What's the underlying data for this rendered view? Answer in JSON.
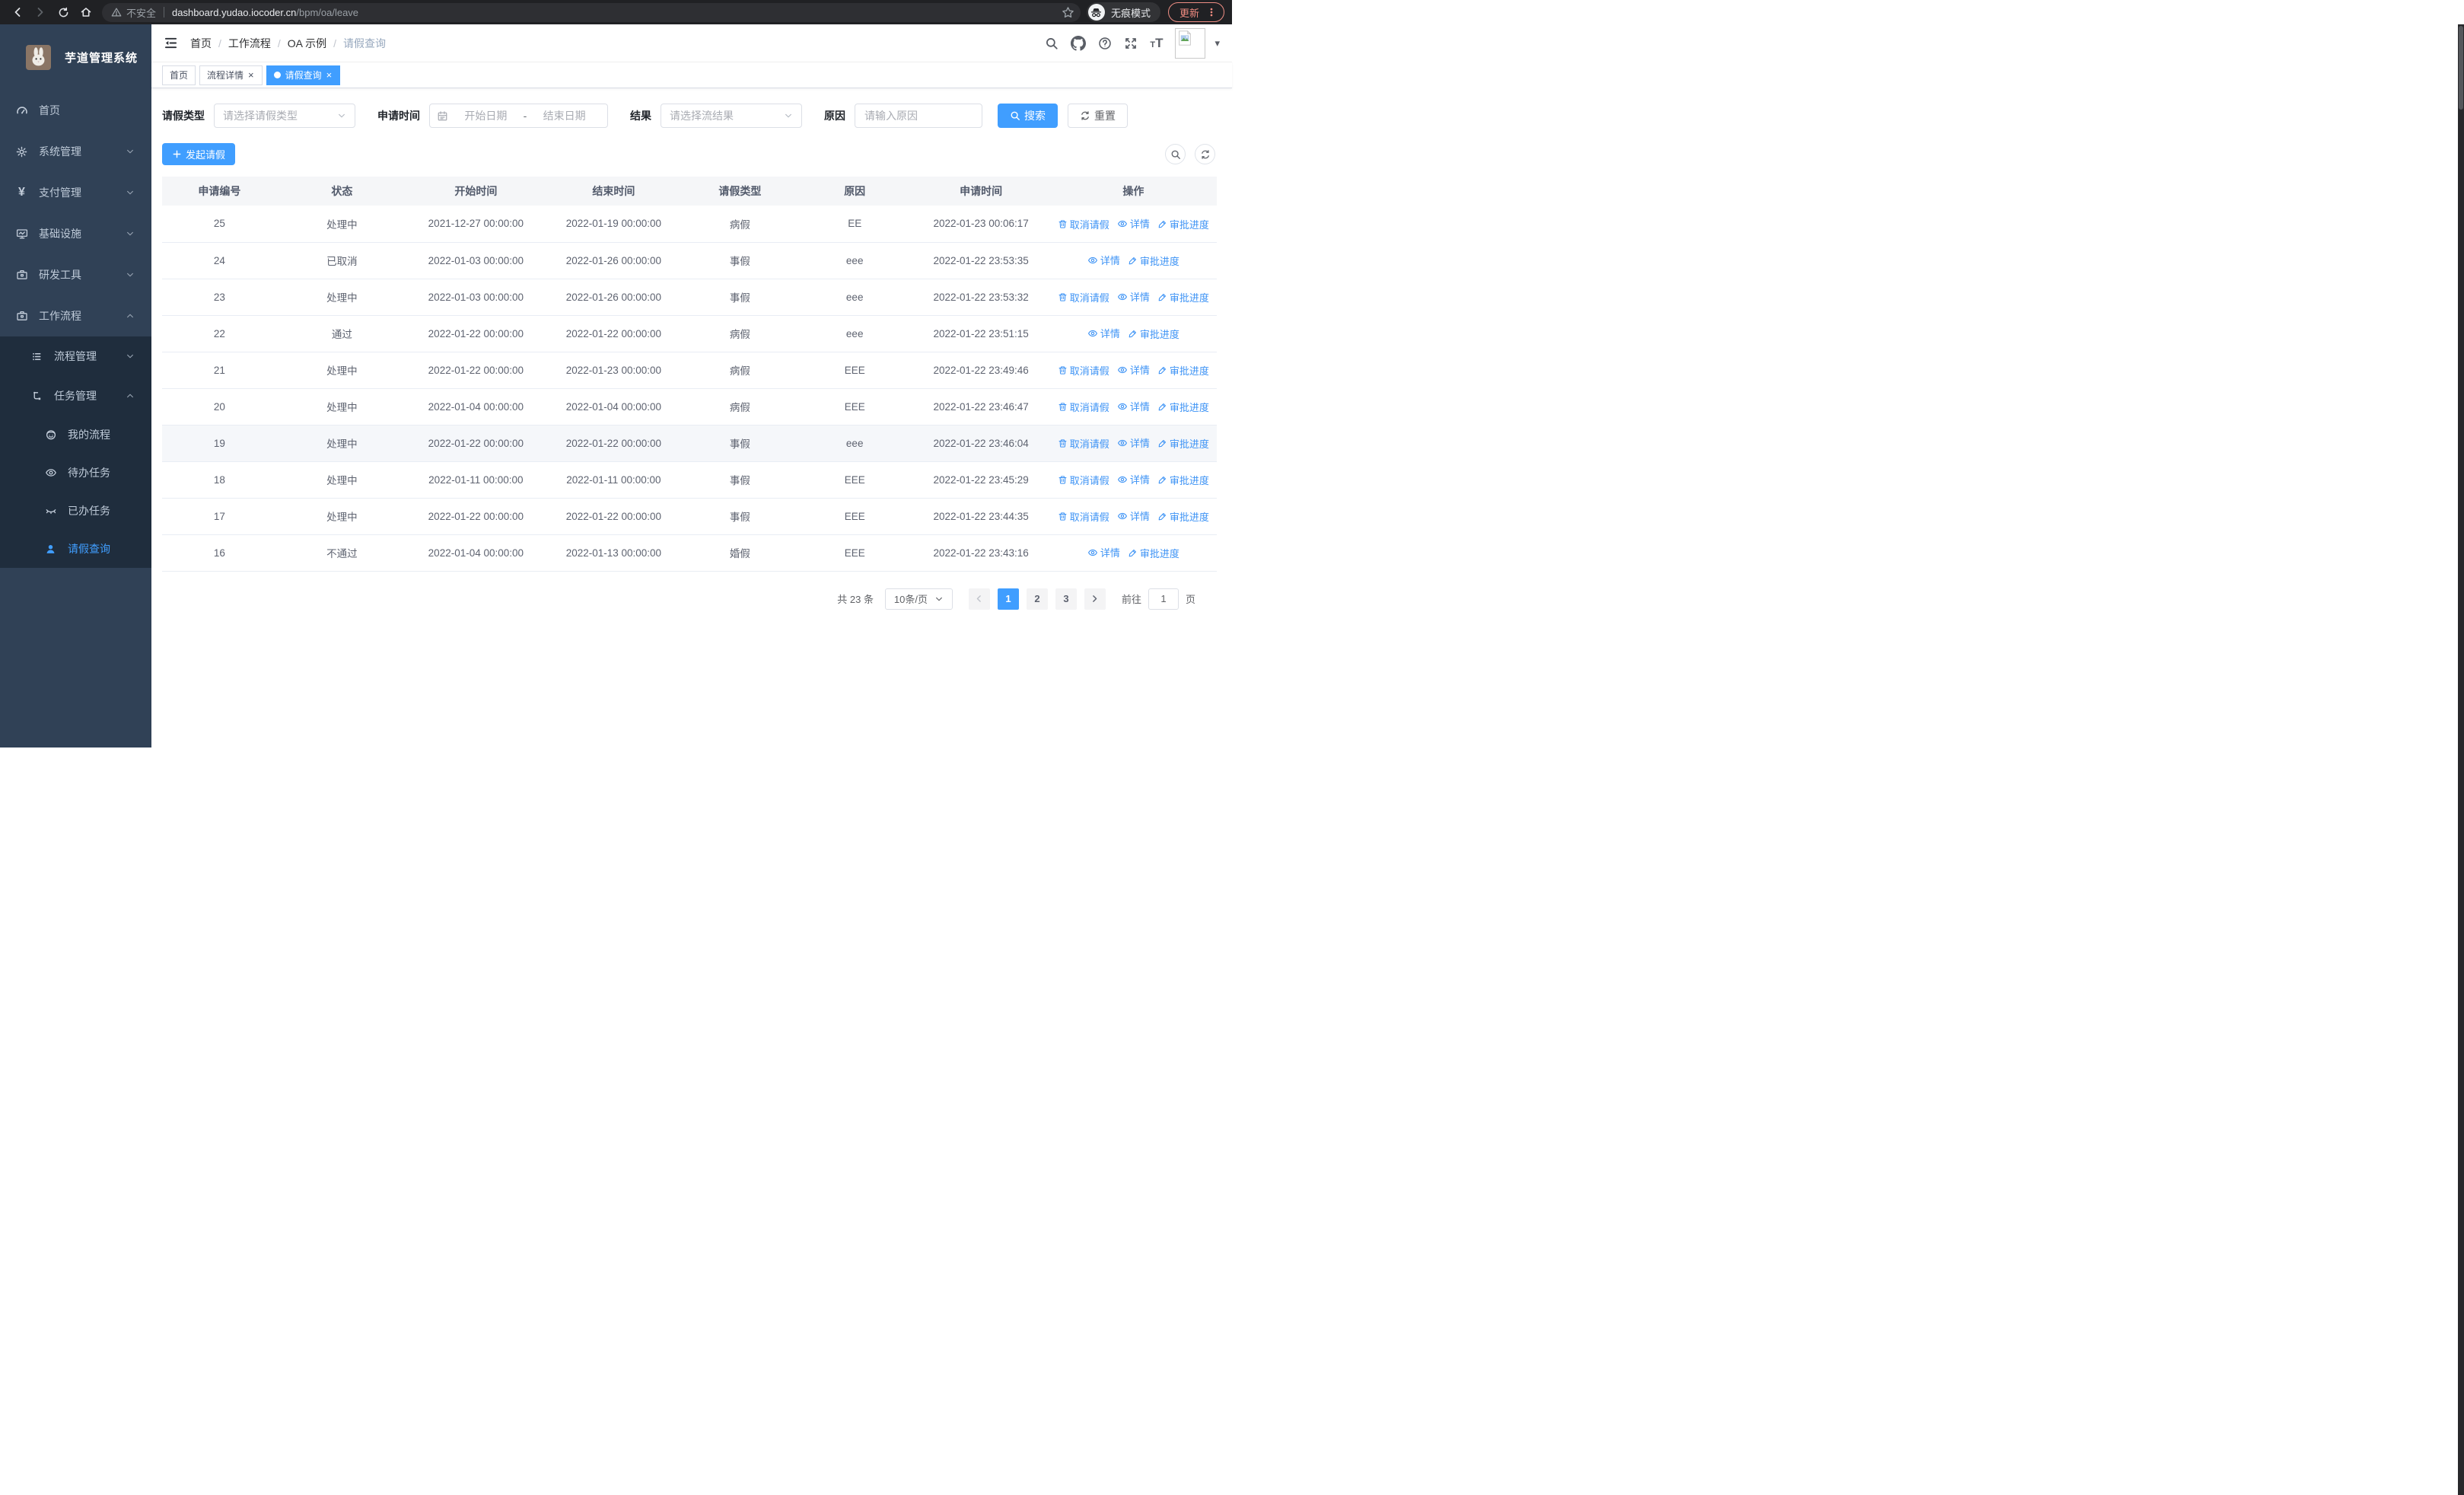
{
  "browser": {
    "security_text": "不安全",
    "url_host": "dashboard.yudao.iocoder.cn",
    "url_path": "/bpm/oa/leave",
    "incognito_label": "无痕模式",
    "update_label": "更新"
  },
  "sidebar": {
    "app_title": "芋道管理系统",
    "items": [
      {
        "name": "home",
        "label": "首页",
        "icon": "dashboard-icon",
        "level": 0,
        "sub": false,
        "chevron": null,
        "active": false
      },
      {
        "name": "system-mgmt",
        "label": "系统管理",
        "icon": "gear-icon",
        "level": 0,
        "sub": false,
        "chevron": "down",
        "active": false
      },
      {
        "name": "payment-mgmt",
        "label": "支付管理",
        "icon": "yen-icon",
        "level": 0,
        "sub": false,
        "chevron": "down",
        "active": false
      },
      {
        "name": "infrastructure",
        "label": "基础设施",
        "icon": "monitor-icon",
        "level": 0,
        "sub": false,
        "chevron": "down",
        "active": false
      },
      {
        "name": "dev-tools",
        "label": "研发工具",
        "icon": "toolbox-icon",
        "level": 0,
        "sub": false,
        "chevron": "down",
        "active": false
      },
      {
        "name": "workflow",
        "label": "工作流程",
        "icon": "briefcase-icon",
        "level": 0,
        "sub": false,
        "chevron": "up",
        "active": false
      },
      {
        "name": "process-mgmt",
        "label": "流程管理",
        "icon": "list-icon",
        "level": 1,
        "sub": true,
        "chevron": "down",
        "active": false
      },
      {
        "name": "task-mgmt",
        "label": "任务管理",
        "icon": "tree-icon",
        "level": 1,
        "sub": true,
        "chevron": "up",
        "active": false
      },
      {
        "name": "my-process",
        "label": "我的流程",
        "icon": "face-icon",
        "level": 2,
        "sub": true,
        "chevron": null,
        "active": false
      },
      {
        "name": "todo-tasks",
        "label": "待办任务",
        "icon": "eye-icon",
        "level": 2,
        "sub": true,
        "chevron": null,
        "active": false
      },
      {
        "name": "done-tasks",
        "label": "已办任务",
        "icon": "eye-closed-icon",
        "level": 2,
        "sub": true,
        "chevron": null,
        "active": false
      },
      {
        "name": "leave-query",
        "label": "请假查询",
        "icon": "user-icon",
        "level": 2,
        "sub": true,
        "chevron": null,
        "active": true
      }
    ]
  },
  "breadcrumb": [
    "首页",
    "工作流程",
    "OA 示例",
    "请假查询"
  ],
  "tabs": [
    {
      "label": "首页",
      "closable": false,
      "active": false
    },
    {
      "label": "流程详情",
      "closable": true,
      "active": false
    },
    {
      "label": "请假查询",
      "closable": true,
      "active": true
    }
  ],
  "filters": {
    "leave_type_label": "请假类型",
    "leave_type_placeholder": "请选择请假类型",
    "apply_time_label": "申请时间",
    "start_placeholder": "开始日期",
    "range_separator": "-",
    "end_placeholder": "结束日期",
    "result_label": "结果",
    "result_placeholder": "请选择流结果",
    "reason_label": "原因",
    "reason_placeholder": "请输入原因",
    "search_label": "搜索",
    "reset_label": "重置"
  },
  "toolbar": {
    "create_label": "发起请假"
  },
  "table": {
    "columns": [
      "申请编号",
      "状态",
      "开始时间",
      "结束时间",
      "请假类型",
      "原因",
      "申请时间",
      "操作"
    ],
    "action_labels": {
      "cancel": "取消请假",
      "detail": "详情",
      "progress": "审批进度"
    },
    "rows": [
      {
        "id": "25",
        "status": "处理中",
        "start": "2021-12-27 00:00:00",
        "end": "2022-01-19 00:00:00",
        "type": "病假",
        "reason": "EE",
        "applied": "2022-01-23 00:06:17",
        "can_cancel": true,
        "highlighted": false
      },
      {
        "id": "24",
        "status": "已取消",
        "start": "2022-01-03 00:00:00",
        "end": "2022-01-26 00:00:00",
        "type": "事假",
        "reason": "eee",
        "applied": "2022-01-22 23:53:35",
        "can_cancel": false,
        "highlighted": false
      },
      {
        "id": "23",
        "status": "处理中",
        "start": "2022-01-03 00:00:00",
        "end": "2022-01-26 00:00:00",
        "type": "事假",
        "reason": "eee",
        "applied": "2022-01-22 23:53:32",
        "can_cancel": true,
        "highlighted": false
      },
      {
        "id": "22",
        "status": "通过",
        "start": "2022-01-22 00:00:00",
        "end": "2022-01-22 00:00:00",
        "type": "病假",
        "reason": "eee",
        "applied": "2022-01-22 23:51:15",
        "can_cancel": false,
        "highlighted": false
      },
      {
        "id": "21",
        "status": "处理中",
        "start": "2022-01-22 00:00:00",
        "end": "2022-01-23 00:00:00",
        "type": "病假",
        "reason": "EEE",
        "applied": "2022-01-22 23:49:46",
        "can_cancel": true,
        "highlighted": false
      },
      {
        "id": "20",
        "status": "处理中",
        "start": "2022-01-04 00:00:00",
        "end": "2022-01-04 00:00:00",
        "type": "病假",
        "reason": "EEE",
        "applied": "2022-01-22 23:46:47",
        "can_cancel": true,
        "highlighted": false
      },
      {
        "id": "19",
        "status": "处理中",
        "start": "2022-01-22 00:00:00",
        "end": "2022-01-22 00:00:00",
        "type": "事假",
        "reason": "eee",
        "applied": "2022-01-22 23:46:04",
        "can_cancel": true,
        "highlighted": true
      },
      {
        "id": "18",
        "status": "处理中",
        "start": "2022-01-11 00:00:00",
        "end": "2022-01-11 00:00:00",
        "type": "事假",
        "reason": "EEE",
        "applied": "2022-01-22 23:45:29",
        "can_cancel": true,
        "highlighted": false
      },
      {
        "id": "17",
        "status": "处理中",
        "start": "2022-01-22 00:00:00",
        "end": "2022-01-22 00:00:00",
        "type": "事假",
        "reason": "EEE",
        "applied": "2022-01-22 23:44:35",
        "can_cancel": true,
        "highlighted": false
      },
      {
        "id": "16",
        "status": "不通过",
        "start": "2022-01-04 00:00:00",
        "end": "2022-01-13 00:00:00",
        "type": "婚假",
        "reason": "EEE",
        "applied": "2022-01-22 23:43:16",
        "can_cancel": false,
        "highlighted": false
      }
    ]
  },
  "pagination": {
    "total_label": "共 23 条",
    "page_size_label": "10条/页",
    "pages": [
      "1",
      "2",
      "3"
    ],
    "active_page": "1",
    "goto_label": "前往",
    "goto_value": "1",
    "goto_suffix": "页"
  },
  "colors": {
    "primary": "#409eff",
    "sidebar_bg": "#304156",
    "submenu_bg": "#1f2d3d",
    "update_accent": "#f08b80",
    "table_header_bg": "#f5f6f8"
  }
}
